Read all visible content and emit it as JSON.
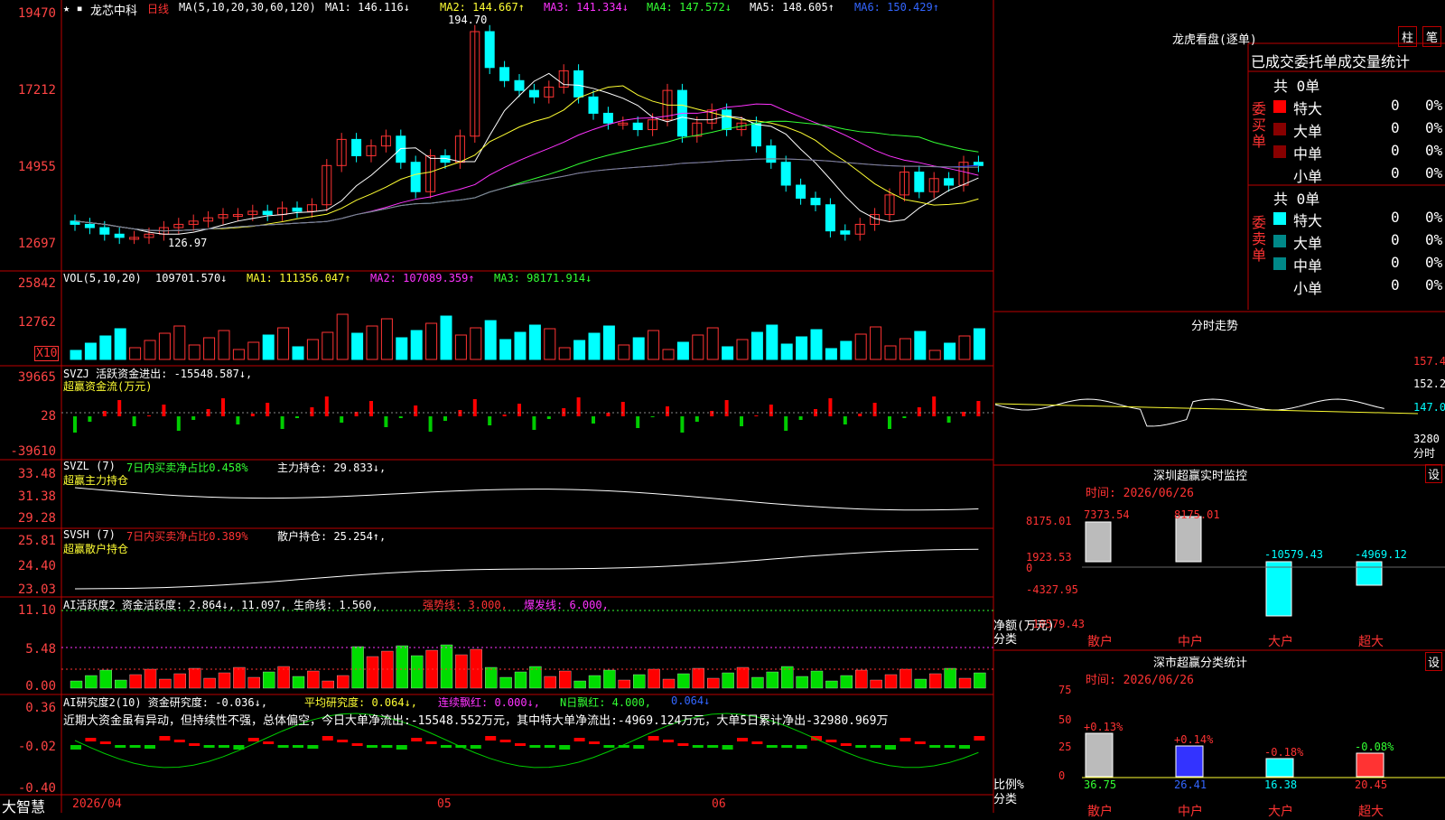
{
  "main": {
    "title": "龙芯中科",
    "period": "日线",
    "ma": "MA(5,10,20,30,60,120)",
    "ma1": "MA1: 146.116↓",
    "ma2": "MA2: 144.667↑",
    "ma3": "MA3: 141.334↓",
    "ma4": "MA4: 147.572↓",
    "ma5": "MA5: 148.605↑",
    "ma6": "MA6: 150.429↑",
    "high": "194.70",
    "low": "126.97",
    "y": [
      "19470",
      "17212",
      "14955",
      "12697"
    ]
  },
  "vol": {
    "label": "VOL(5,10,20)",
    "v": "109701.570↓",
    "ma1": "MA1: 111356.047↑",
    "ma2": "MA2: 107089.359↑",
    "ma3": "MA3: 98171.914↓",
    "y": [
      "25842",
      "12762"
    ],
    "unit": "X10"
  },
  "svzj": {
    "label": "SVZJ  活跃资金进出: -15548.587↓,",
    "sub": "超赢资金流(万元)",
    "y": [
      "39665",
      "28",
      "-39610"
    ]
  },
  "svzl": {
    "label": "SVZL (7)",
    "t1": "7日内买卖净占比0.458%",
    "t2": "主力持仓: 29.833↓,",
    "sub": "超赢主力持仓",
    "y": [
      "33.48",
      "31.38",
      "29.28"
    ]
  },
  "svsh": {
    "label": "SVSH (7)",
    "t1": "7日内买卖净占比0.389%",
    "t2": "散户持仓: 25.254↑,",
    "sub": "超赢散户持仓",
    "y": [
      "25.81",
      "24.40",
      "23.03"
    ]
  },
  "ai": {
    "label": "AI活跃度2 资金活跃度: 2.864↓, 11.097, 生命线: 1.560,",
    "t1": "强势线: 3.000,",
    "t2": "爆发线: 6.000,",
    "y": [
      "11.10",
      "5.48",
      "0.00"
    ]
  },
  "ai2": {
    "label": "AI研究度2(10) 资金研究度: -0.036↓,",
    "t1": "平均研究度: 0.064↓,",
    "t2": "连续飘红: 0.000↓,",
    "t3": "N日飘红: 4.000,",
    "t4": "0.064↓",
    "note": "近期大资金虽有异动，但持续性不强，总体偏空，今日大单净流出:-15548.552万元，其中特大单净流出:-4969.124万元，大单5日累计净出-32980.969万",
    "y": [
      "0.36",
      "-0.02",
      "-0.40"
    ]
  },
  "xaxis": {
    "brand": "大智慧",
    "d1": "2026/04",
    "d2": "05",
    "d3": "06"
  },
  "right": {
    "title": "龙虎看盘(逐单)",
    "btn1": "柱",
    "btn2": "笔",
    "head": "已成交委托单成交量统计",
    "buy": "委买单",
    "sell": "委卖单",
    "buyTotal": "共 0单",
    "sellTotal": "共 0单",
    "rows": [
      "特大",
      "大单",
      "中单",
      "小单"
    ],
    "zero": "0",
    "pct": "0%",
    "fs": "分时走势",
    "fsy": [
      "157.4",
      "152.2",
      "147.0",
      "3280",
      "分时"
    ],
    "sz": "深圳超赢实时监控",
    "set": "设",
    "date": "时间: 2026/06/26",
    "szy": [
      "8175.01",
      "1923.53",
      "0",
      "-4327.95",
      "-10579.43"
    ],
    "szv": [
      "7373.54",
      "8175.01",
      "-10579.43",
      "-4969.12"
    ],
    "szu": "净额(万元)",
    "cat": "分类",
    "cats": [
      "散户",
      "中户",
      "大户",
      "超大"
    ],
    "sc": "深市超赢分类统计",
    "scy": [
      "75",
      "50",
      "25",
      "0"
    ],
    "scp": [
      "+0.13%",
      "+0.14%",
      "-0.18%",
      "-0.08%"
    ],
    "scv": [
      "36.75",
      "26.41",
      "16.38",
      "20.45"
    ],
    "scu": "比例%"
  }
}
